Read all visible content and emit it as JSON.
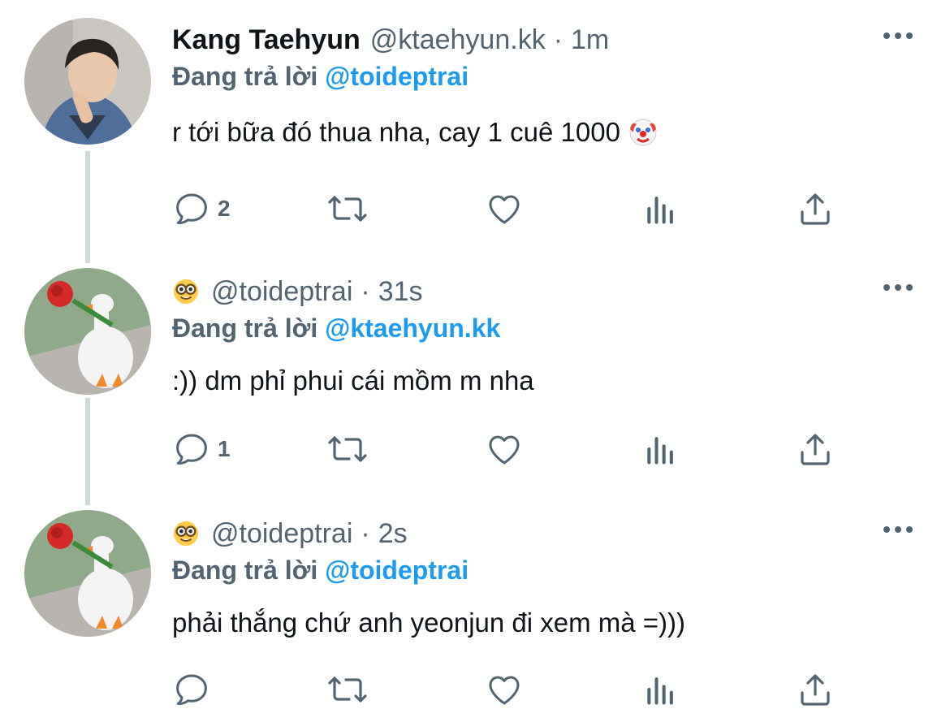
{
  "tweets": [
    {
      "display_name": "Kang Taehyun",
      "handle": "@ktaehyun.kk",
      "separator": "·",
      "time": "1m",
      "reply_prefix": "Đang trả lời",
      "reply_to": "@toideptrai",
      "text": "r tới bữa đó thua nha, cay 1 cuê 1000",
      "text_emoji": "clown-face",
      "reply_count": "2",
      "avatar": "person-photo"
    },
    {
      "display_name": "",
      "name_emoji": "nerd-face",
      "handle": "@toideptrai",
      "separator": "·",
      "time": "31s",
      "reply_prefix": "Đang trả lời",
      "reply_to": "@ktaehyun.kk",
      "text": ":)) dm phỉ phui cái mồm m nha",
      "reply_count": "1",
      "avatar": "goose-with-rose"
    },
    {
      "display_name": "",
      "name_emoji": "nerd-face",
      "handle": "@toideptrai",
      "separator": "·",
      "time": "2s",
      "reply_prefix": "Đang trả lời",
      "reply_to": "@toideptrai",
      "text": "phải thắng chứ anh yeonjun đi xem mà =)))",
      "reply_count": "",
      "avatar": "goose-with-rose"
    }
  ],
  "actions": [
    "reply-icon",
    "retweet-icon",
    "like-icon",
    "views-icon",
    "share-icon"
  ],
  "colors": {
    "mention": "#1d9bf0",
    "secondary_text": "#536471",
    "primary_text": "#0f1419",
    "thread_line": "#cfd9de"
  }
}
